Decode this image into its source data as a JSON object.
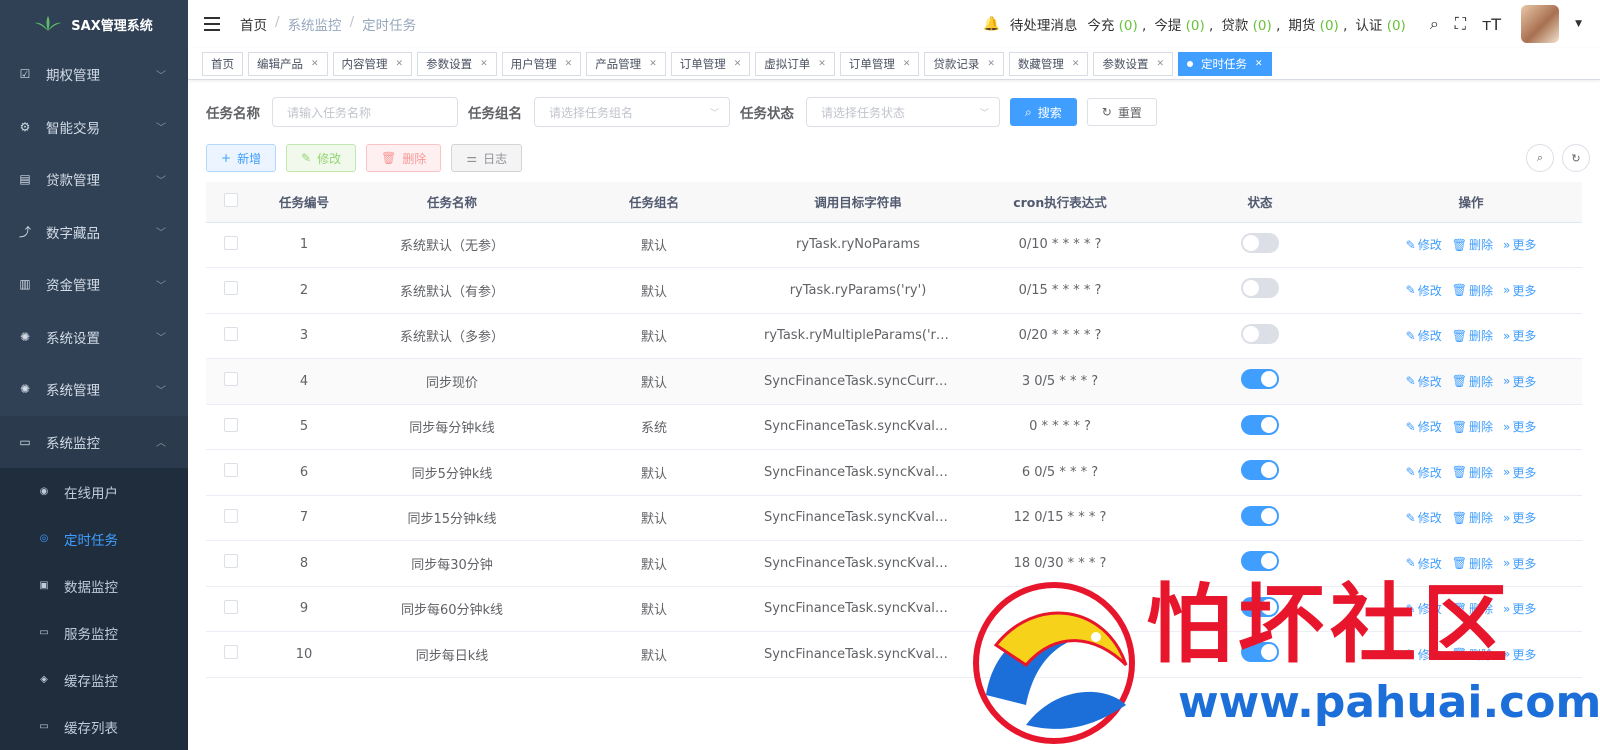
{
  "app": {
    "title": "SAX管理系统"
  },
  "sidebar": {
    "items": [
      {
        "label": "期权管理",
        "icon": "list-check-icon"
      },
      {
        "label": "智能交易",
        "icon": "gear-icon"
      },
      {
        "label": "贷款管理",
        "icon": "loan-icon"
      },
      {
        "label": "数字藏品",
        "icon": "graph-icon"
      },
      {
        "label": "资金管理",
        "icon": "money-icon"
      },
      {
        "label": "系统设置",
        "icon": "settings-icon"
      },
      {
        "label": "系统管理",
        "icon": "settings-icon"
      },
      {
        "label": "系统监控",
        "icon": "monitor-icon"
      }
    ],
    "submenu": [
      {
        "label": "在线用户",
        "icon": "online-icon"
      },
      {
        "label": "定时任务",
        "icon": "job-icon"
      },
      {
        "label": "数据监控",
        "icon": "druid-icon"
      },
      {
        "label": "服务监控",
        "icon": "server-icon"
      },
      {
        "label": "缓存监控",
        "icon": "redis-icon"
      },
      {
        "label": "缓存列表",
        "icon": "redis-list-icon"
      }
    ]
  },
  "breadcrumb": [
    "首页",
    "系统监控",
    "定时任务"
  ],
  "notifications": {
    "label": "待处理消息",
    "items": [
      {
        "label": "今充",
        "count": "(0)"
      },
      {
        "label": "今提",
        "count": "(0)"
      },
      {
        "label": "贷款",
        "count": "(0)"
      },
      {
        "label": "期货",
        "count": "(0)"
      },
      {
        "label": "认证",
        "count": "(0)"
      }
    ]
  },
  "tags": [
    "首页",
    "编辑产品",
    "内容管理",
    "参数设置",
    "用户管理",
    "产品管理",
    "订单管理",
    "虚拟订单",
    "订单管理",
    "贷款记录",
    "数藏管理",
    "参数设置",
    "定时任务"
  ],
  "search": {
    "job_name_label": "任务名称",
    "job_name_placeholder": "请输入任务名称",
    "job_group_label": "任务组名",
    "job_group_placeholder": "请选择任务组名",
    "status_label": "任务状态",
    "status_placeholder": "请选择任务状态",
    "search_btn": "搜索",
    "reset_btn": "重置"
  },
  "toolbar": {
    "add": "新增",
    "edit": "修改",
    "delete": "删除",
    "log": "日志"
  },
  "table": {
    "headers": [
      "任务编号",
      "任务名称",
      "任务组名",
      "调用目标字符串",
      "cron执行表达式",
      "状态",
      "操作"
    ],
    "rows": [
      {
        "id": "1",
        "name": "系统默认（无参）",
        "group": "默认",
        "target": "ryTask.ryNoParams",
        "cron": "0/10 * * * * ?",
        "on": false
      },
      {
        "id": "2",
        "name": "系统默认（有参）",
        "group": "默认",
        "target": "ryTask.ryParams('ry')",
        "cron": "0/15 * * * * ?",
        "on": false
      },
      {
        "id": "3",
        "name": "系统默认（多参）",
        "group": "默认",
        "target": "ryTask.ryMultipleParams('ry', ...",
        "cron": "0/20 * * * * ?",
        "on": false
      },
      {
        "id": "4",
        "name": "同步现价",
        "group": "默认",
        "target": "SyncFinanceTask.syncCurre...",
        "cron": "3 0/5 * * * ?",
        "on": true
      },
      {
        "id": "5",
        "name": "同步每分钟k线",
        "group": "系统",
        "target": "SyncFinanceTask.syncKvalu...",
        "cron": "0 * * * * ?",
        "on": true
      },
      {
        "id": "6",
        "name": "同步5分钟k线",
        "group": "默认",
        "target": "SyncFinanceTask.syncKvalu...",
        "cron": "6 0/5 * * * ?",
        "on": true
      },
      {
        "id": "7",
        "name": "同步15分钟k线",
        "group": "默认",
        "target": "SyncFinanceTask.syncKvalu...",
        "cron": "12 0/15 * * * ?",
        "on": true
      },
      {
        "id": "8",
        "name": "同步每30分钟",
        "group": "默认",
        "target": "SyncFinanceTask.syncKvalu...",
        "cron": "18 0/30 * * * ?",
        "on": true
      },
      {
        "id": "9",
        "name": "同步每60分钟k线",
        "group": "默认",
        "target": "SyncFinanceTask.syncKvalu...",
        "cron": "",
        "on": true
      },
      {
        "id": "10",
        "name": "同步每日k线",
        "group": "默认",
        "target": "SyncFinanceTask.syncKvalu...",
        "cron": "",
        "on": true
      }
    ],
    "ops": {
      "edit": "修改",
      "delete": "删除",
      "more": "更多"
    }
  },
  "watermark": {
    "text": "怕坏社区",
    "url": "www.pahuai.com"
  }
}
